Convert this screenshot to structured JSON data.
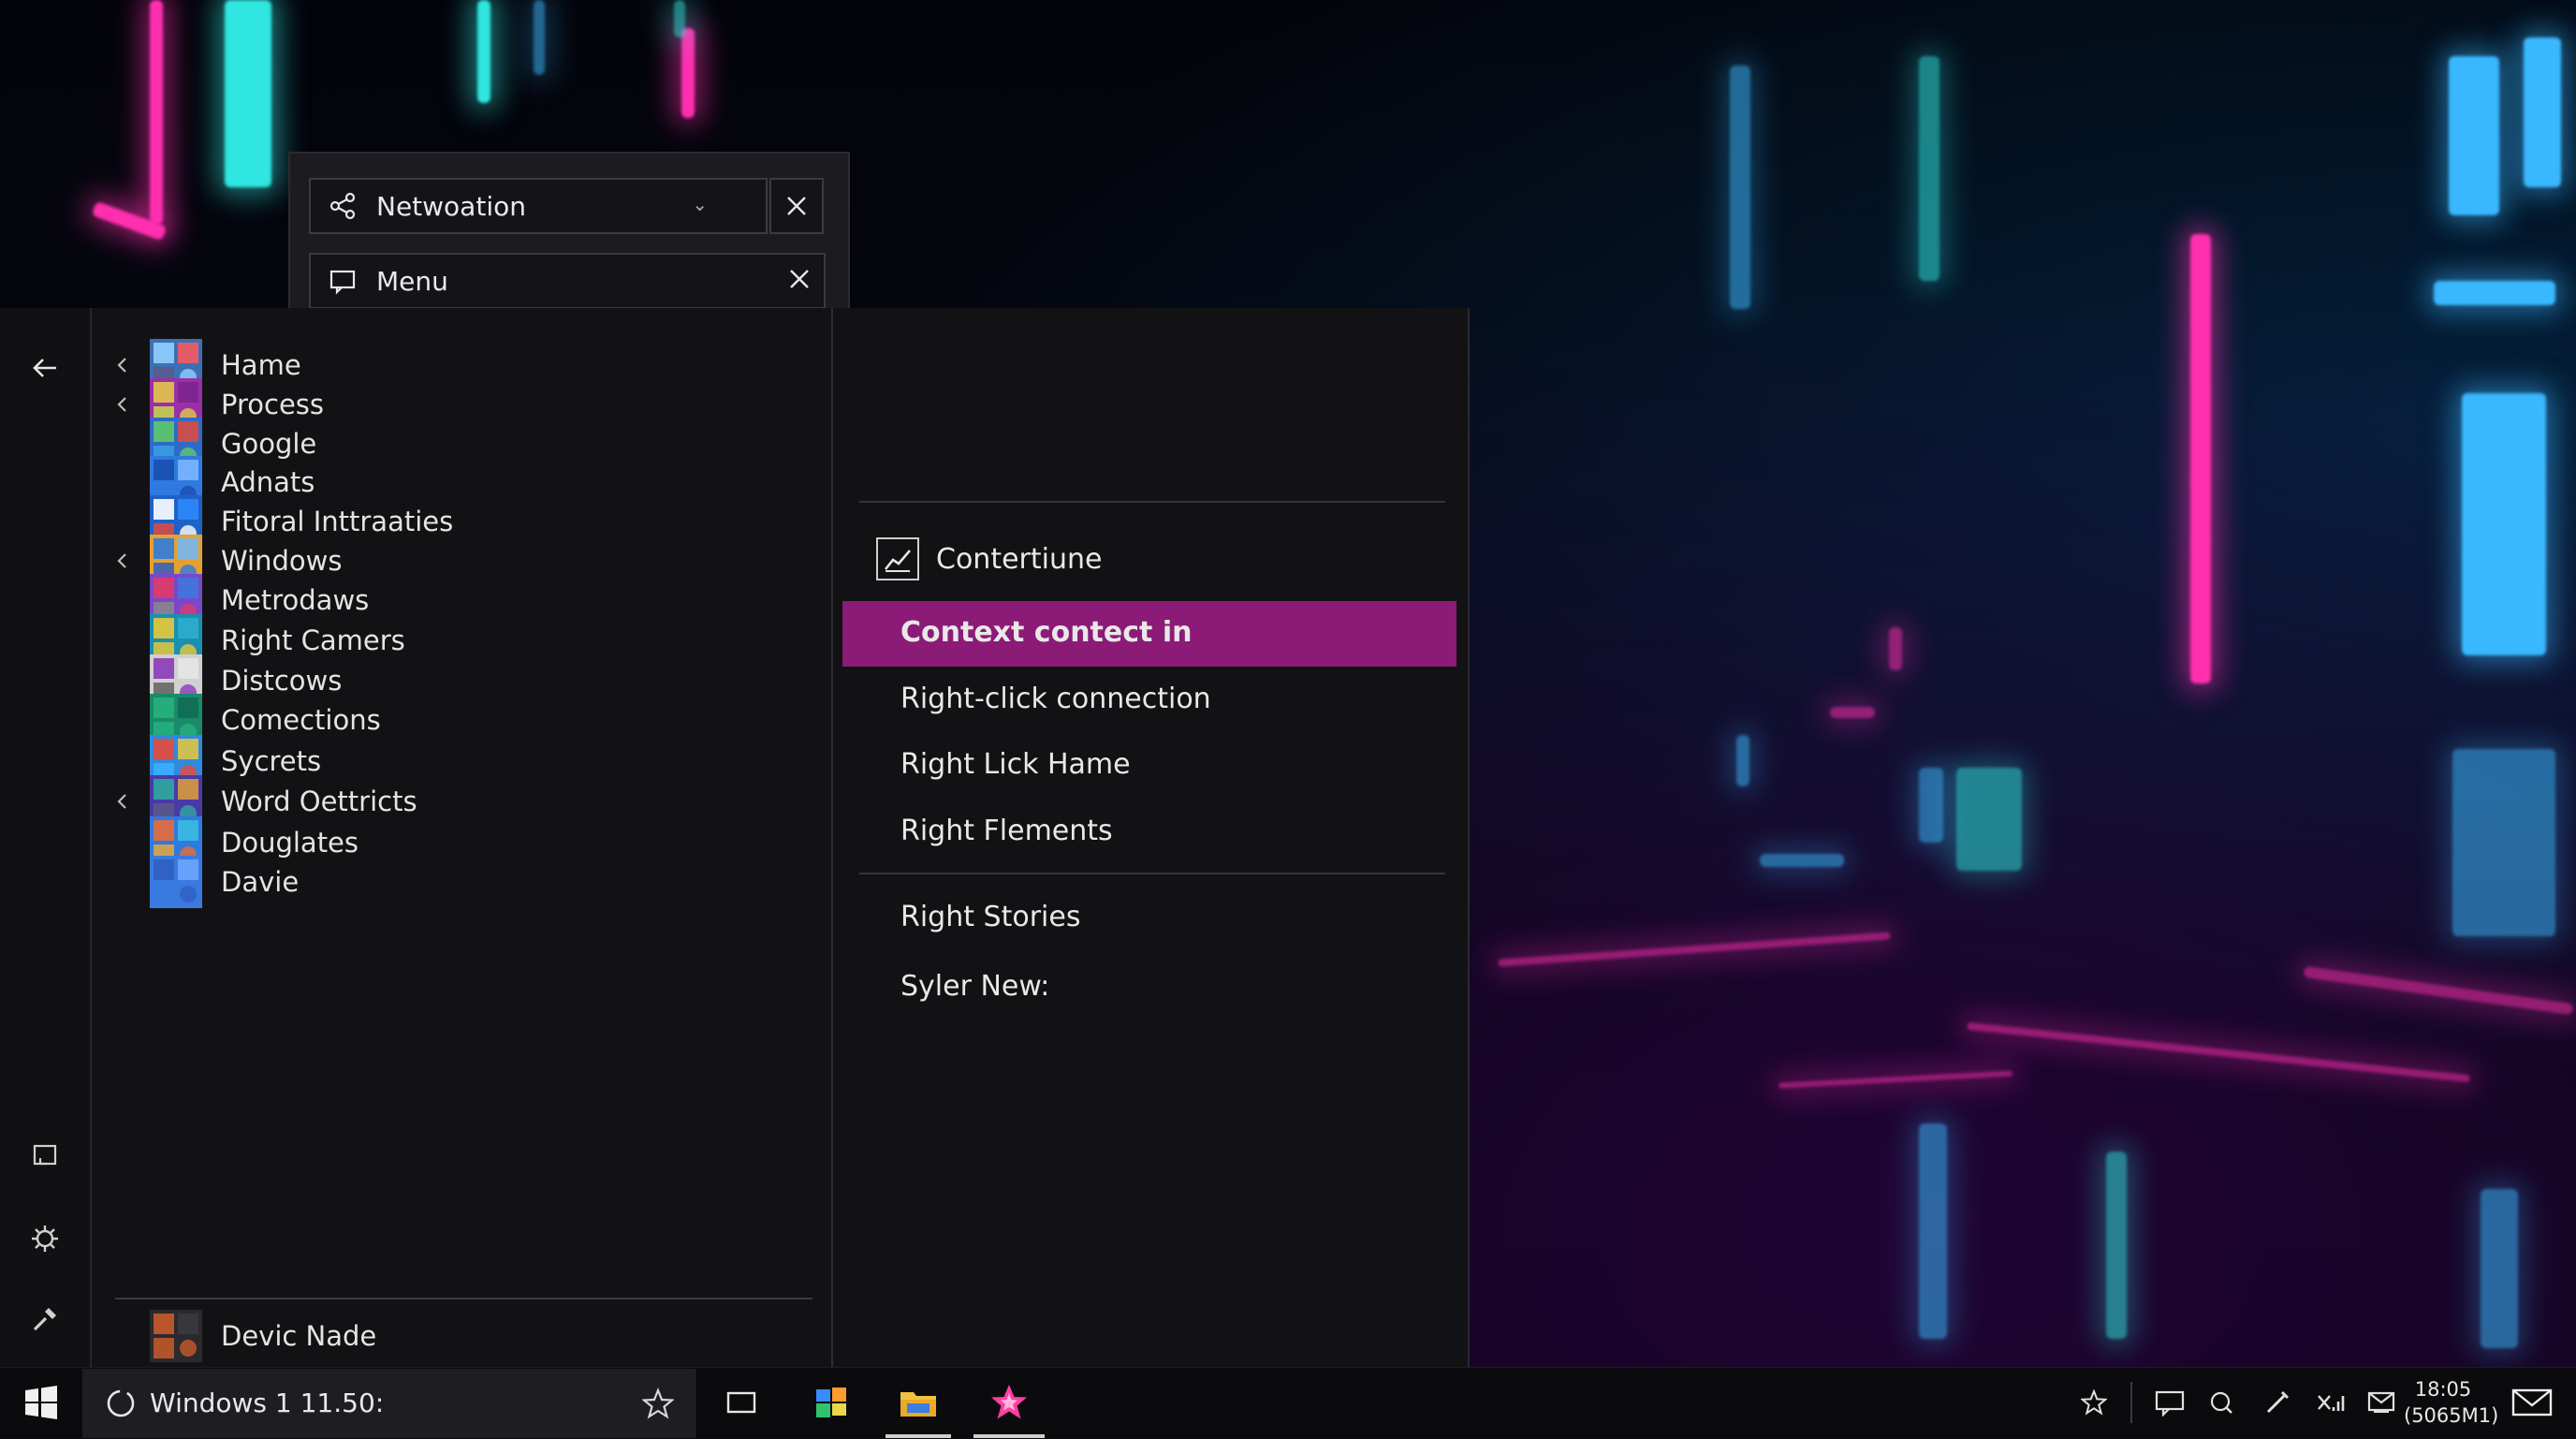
{
  "search_bar": {
    "network_label": "Netwoation",
    "menu_label": "Menu"
  },
  "start_list": {
    "items": [
      {
        "label": "Hame",
        "expandable": true,
        "icon": "hame-icon"
      },
      {
        "label": "Process",
        "expandable": true,
        "icon": "process-icon"
      },
      {
        "label": "Google",
        "expandable": false,
        "icon": "google-icon"
      },
      {
        "label": "Adnats",
        "expandable": false,
        "icon": "adnats-icon"
      },
      {
        "label": "Fitoral Inttraaties",
        "expandable": false,
        "icon": "fitoral-icon"
      },
      {
        "label": "Windows",
        "expandable": true,
        "icon": "windows-icon"
      },
      {
        "label": "Metrodaws",
        "expandable": false,
        "icon": "metrodaws-icon"
      },
      {
        "label": "Right Camers",
        "expandable": false,
        "icon": "camera-icon"
      },
      {
        "label": "Distcows",
        "expandable": false,
        "icon": "distcows-icon"
      },
      {
        "label": "Comections",
        "expandable": false,
        "icon": "connections-icon"
      },
      {
        "label": "Sycrets",
        "expandable": false,
        "icon": "sycrets-icon"
      },
      {
        "label": "Word Oettricts",
        "expandable": true,
        "icon": "word-icon"
      },
      {
        "label": "Douglates",
        "expandable": false,
        "icon": "douglates-icon"
      },
      {
        "label": "Davie",
        "expandable": false,
        "icon": "davie-icon"
      }
    ],
    "footer_item": {
      "label": "Devic Nade",
      "icon": "devic-icon"
    }
  },
  "context_menu": {
    "header": "Contertiune",
    "items": [
      {
        "label": "Context contect in",
        "selected": true
      },
      {
        "label": "Right-click connection",
        "selected": false
      },
      {
        "label": "Right Lick Hame",
        "selected": false
      },
      {
        "label": "Right Flements",
        "selected": false
      }
    ],
    "items2": [
      {
        "label": "Right Stories"
      },
      {
        "label": "Syler New:"
      }
    ]
  },
  "taskbar": {
    "search_text": "Windows 1 11.50:",
    "clock_time": "18:05",
    "clock_sub": "(5065M1)"
  },
  "colors": {
    "accent": "#8c1a77",
    "panel": "#121215",
    "taskbar": "#0b0b0e"
  }
}
